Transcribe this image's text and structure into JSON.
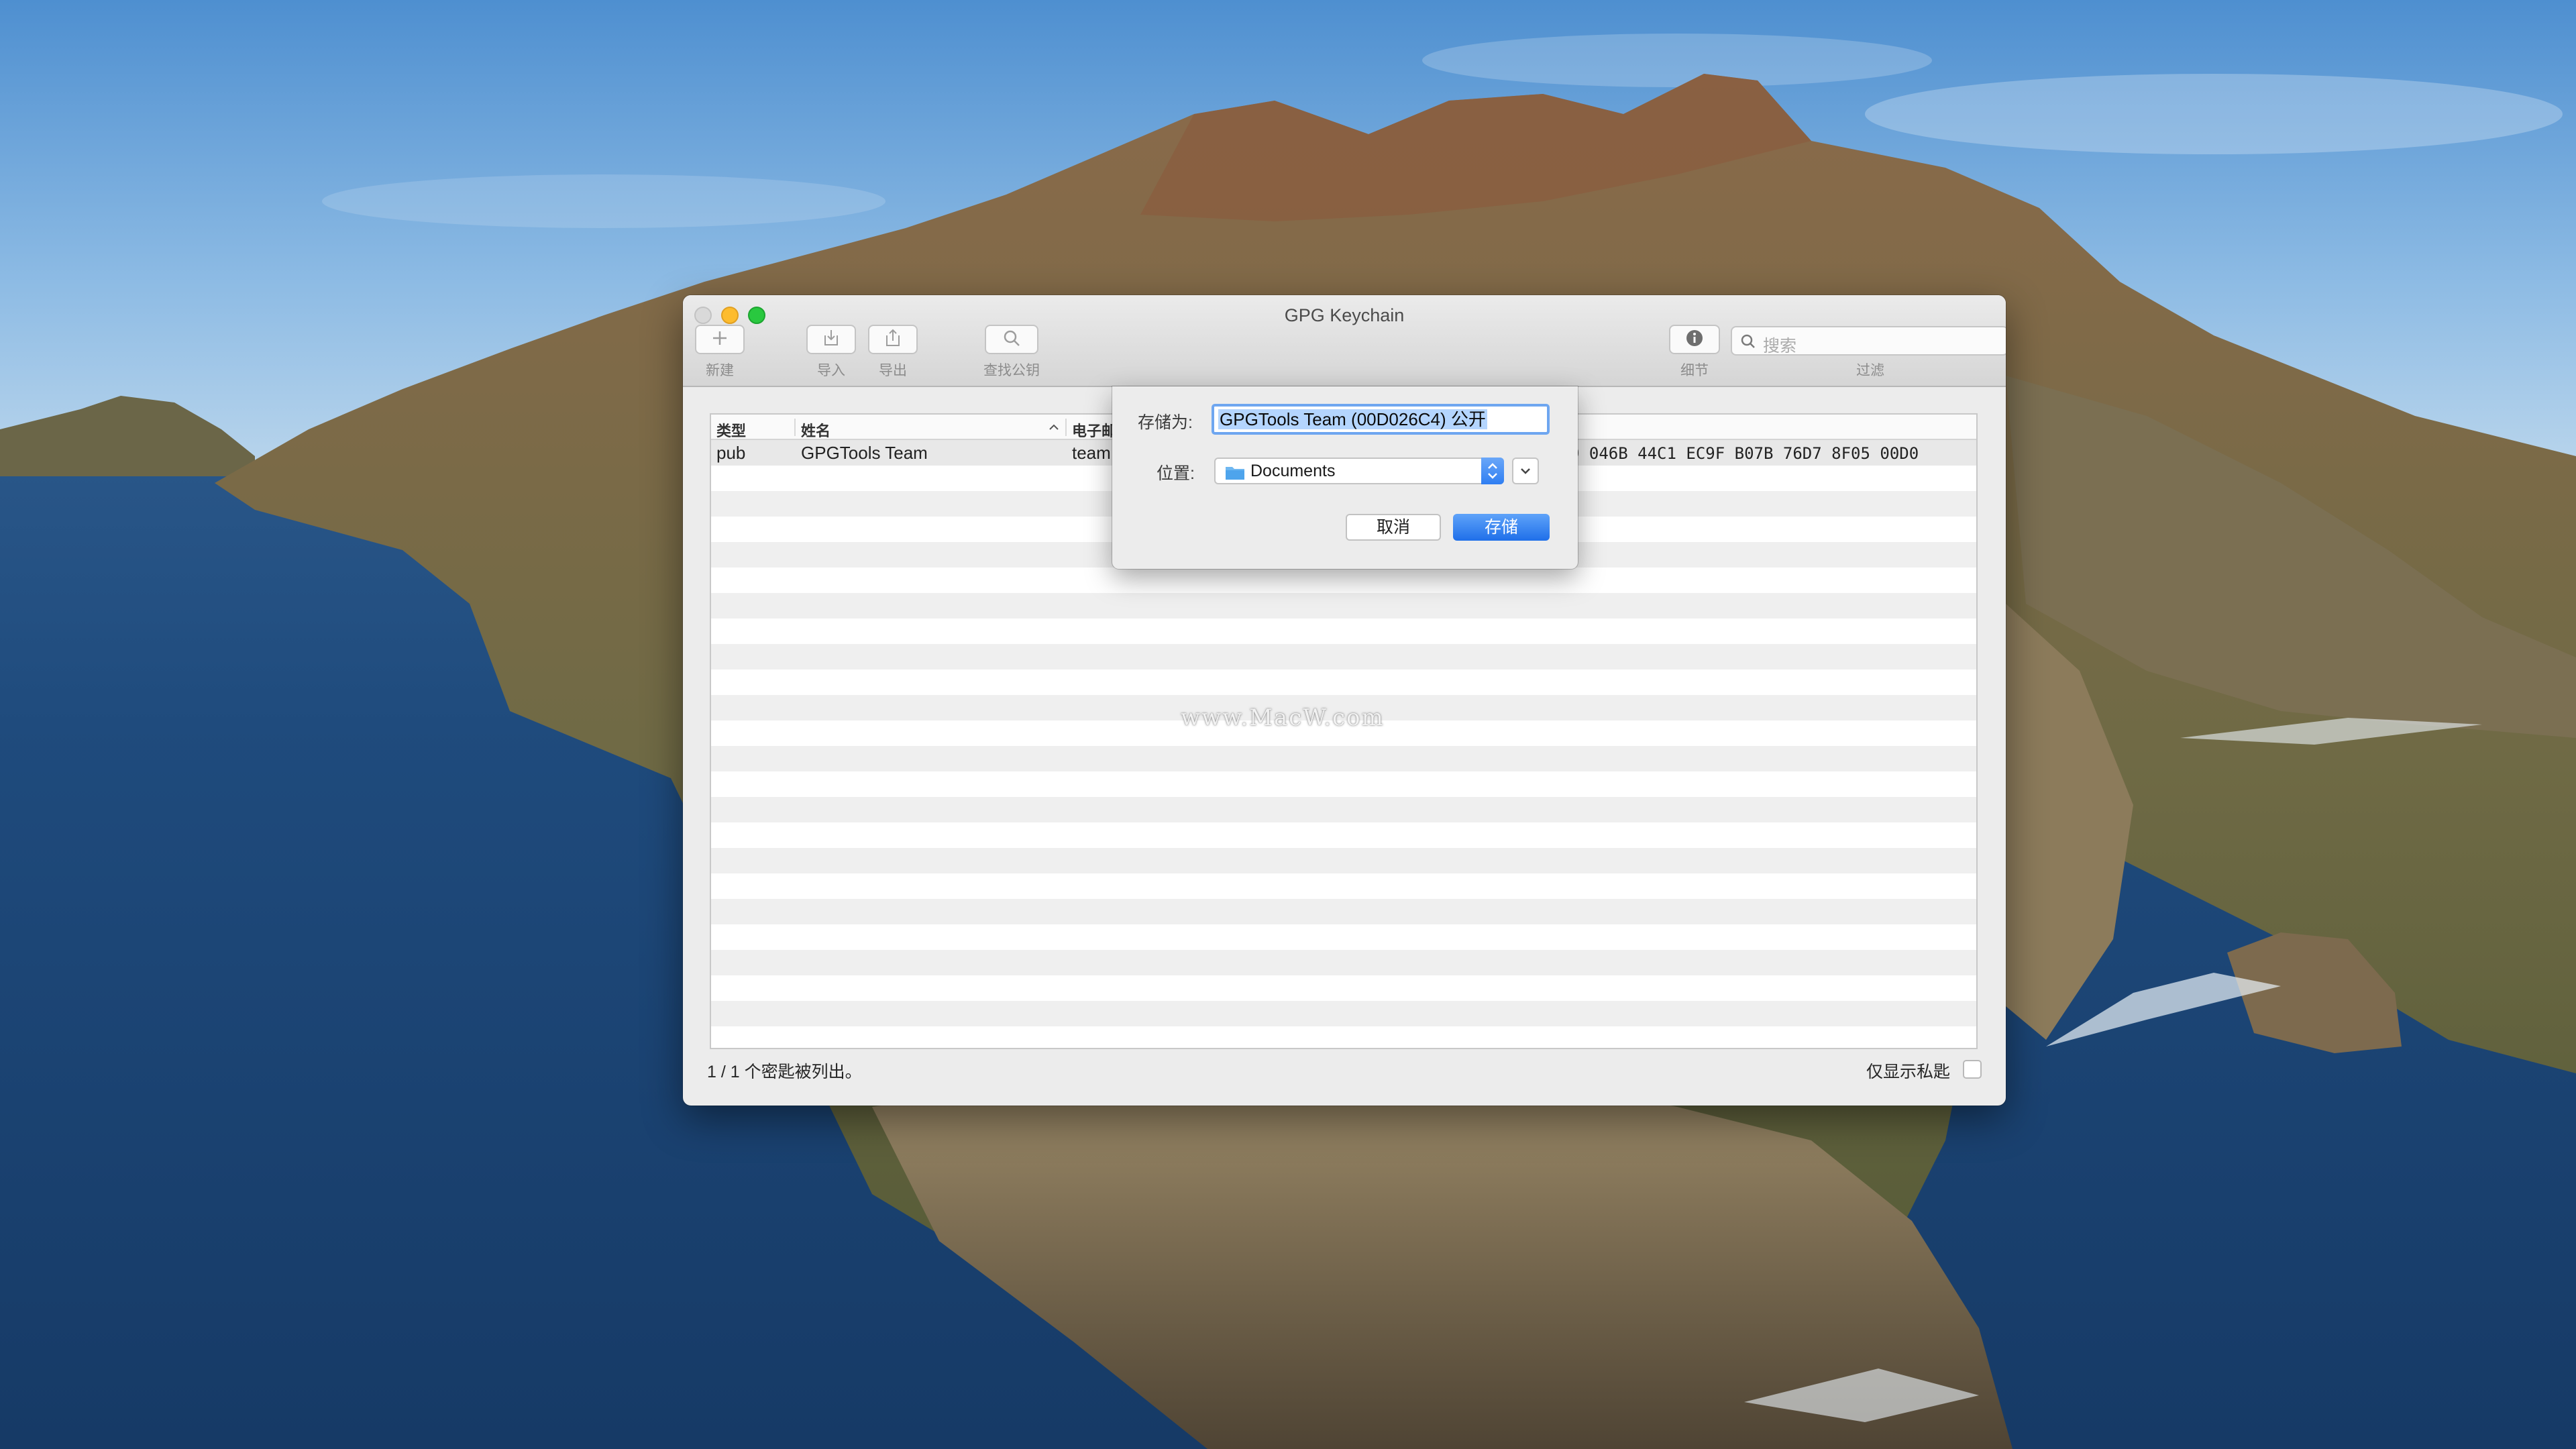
{
  "window": {
    "title": "GPG Keychain"
  },
  "toolbar": {
    "new_label": "新建",
    "import_label": "导入",
    "export_label": "导出",
    "lookup_label": "查找公钥",
    "details_label": "细节",
    "filter_label": "过滤",
    "search_placeholder": "搜索"
  },
  "table": {
    "columns": [
      "类型",
      "姓名",
      "电子邮"
    ],
    "sort_indicator": "^",
    "rows": [
      {
        "type": "pub",
        "name": "GPGTools Team",
        "email": "team",
        "fingerprint": "9 046B 44C1 EC9F  B07B 76D7 8F05 00D0"
      }
    ]
  },
  "status": {
    "count_text": "1 / 1 个密匙被列出。",
    "private_only_label": "仅显示私匙"
  },
  "save_sheet": {
    "save_as_label": "存储为:",
    "filename": "GPGTools Team (00D026C4) 公开",
    "location_label": "位置:",
    "location_value": "Documents",
    "cancel_label": "取消",
    "save_label": "存储"
  },
  "watermark": "www.MacW.com",
  "colors": {
    "accent": "#2f7ef2",
    "close": "#d9d9d9",
    "minimize": "#fdbc2e",
    "maximize": "#29c83f"
  }
}
